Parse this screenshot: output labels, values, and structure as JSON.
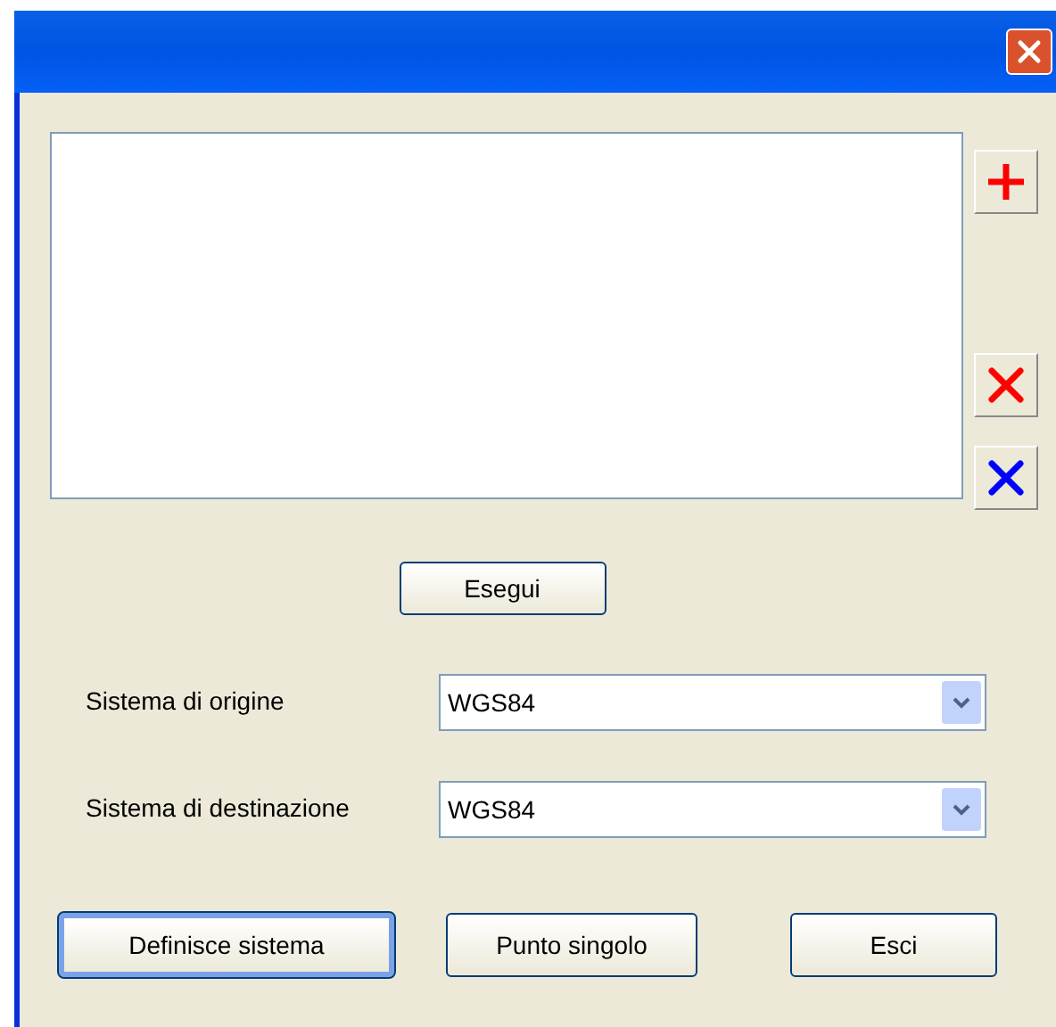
{
  "list_tools": [
    {
      "kind": "add"
    },
    {
      "kind": "delete"
    },
    {
      "kind": "clear"
    }
  ],
  "run_button": {
    "label": "Esegui"
  },
  "fields": [
    {
      "label": "Sistema di origine",
      "value": "WGS84"
    },
    {
      "label": "Sistema di destinazione",
      "value": "WGS84"
    }
  ],
  "buttons": [
    {
      "label": "Definisce sistema",
      "default": true
    },
    {
      "label": "Punto singolo",
      "default": false
    },
    {
      "label": "Esci",
      "default": false
    }
  ]
}
